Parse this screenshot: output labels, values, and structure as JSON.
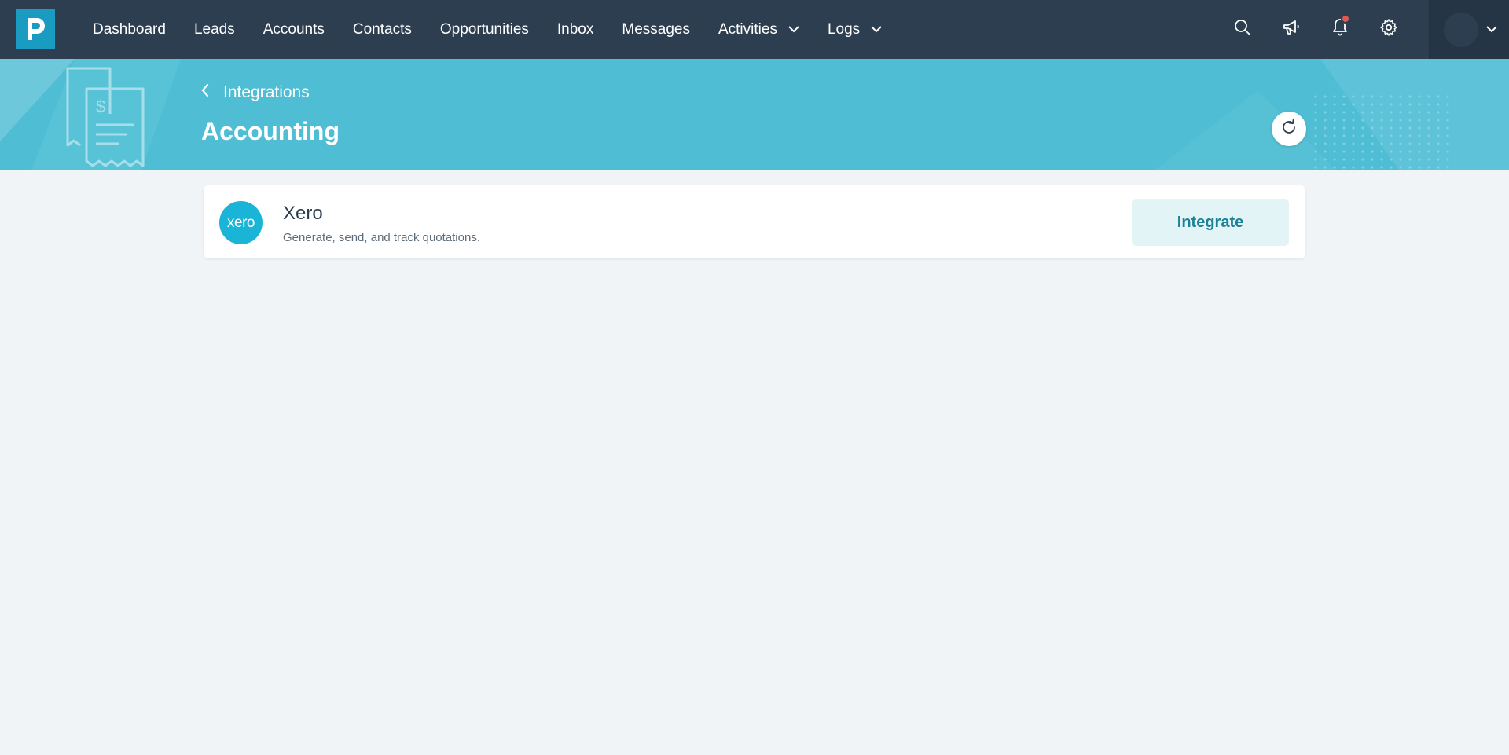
{
  "nav": {
    "items": [
      {
        "label": "Dashboard",
        "dropdown": false
      },
      {
        "label": "Leads",
        "dropdown": false
      },
      {
        "label": "Accounts",
        "dropdown": false
      },
      {
        "label": "Contacts",
        "dropdown": false
      },
      {
        "label": "Opportunities",
        "dropdown": false
      },
      {
        "label": "Inbox",
        "dropdown": false
      },
      {
        "label": "Messages",
        "dropdown": false
      },
      {
        "label": "Activities",
        "dropdown": true
      },
      {
        "label": "Logs",
        "dropdown": true
      }
    ],
    "icons": [
      "search-icon",
      "megaphone-icon",
      "bell-icon",
      "gear-icon"
    ],
    "has_notification": true
  },
  "banner": {
    "back_label": "Integrations",
    "title": "Accounting"
  },
  "integrations": [
    {
      "name": "Xero",
      "logo_text": "xero",
      "description": "Generate, send, and track quotations.",
      "action_label": "Integrate"
    }
  ],
  "colors": {
    "nav_bg": "#2d3e50",
    "banner_bg": "#4fbdd3",
    "brand": "#1a9cc2",
    "xero": "#1ab4d7",
    "page_bg": "#f0f4f7"
  }
}
